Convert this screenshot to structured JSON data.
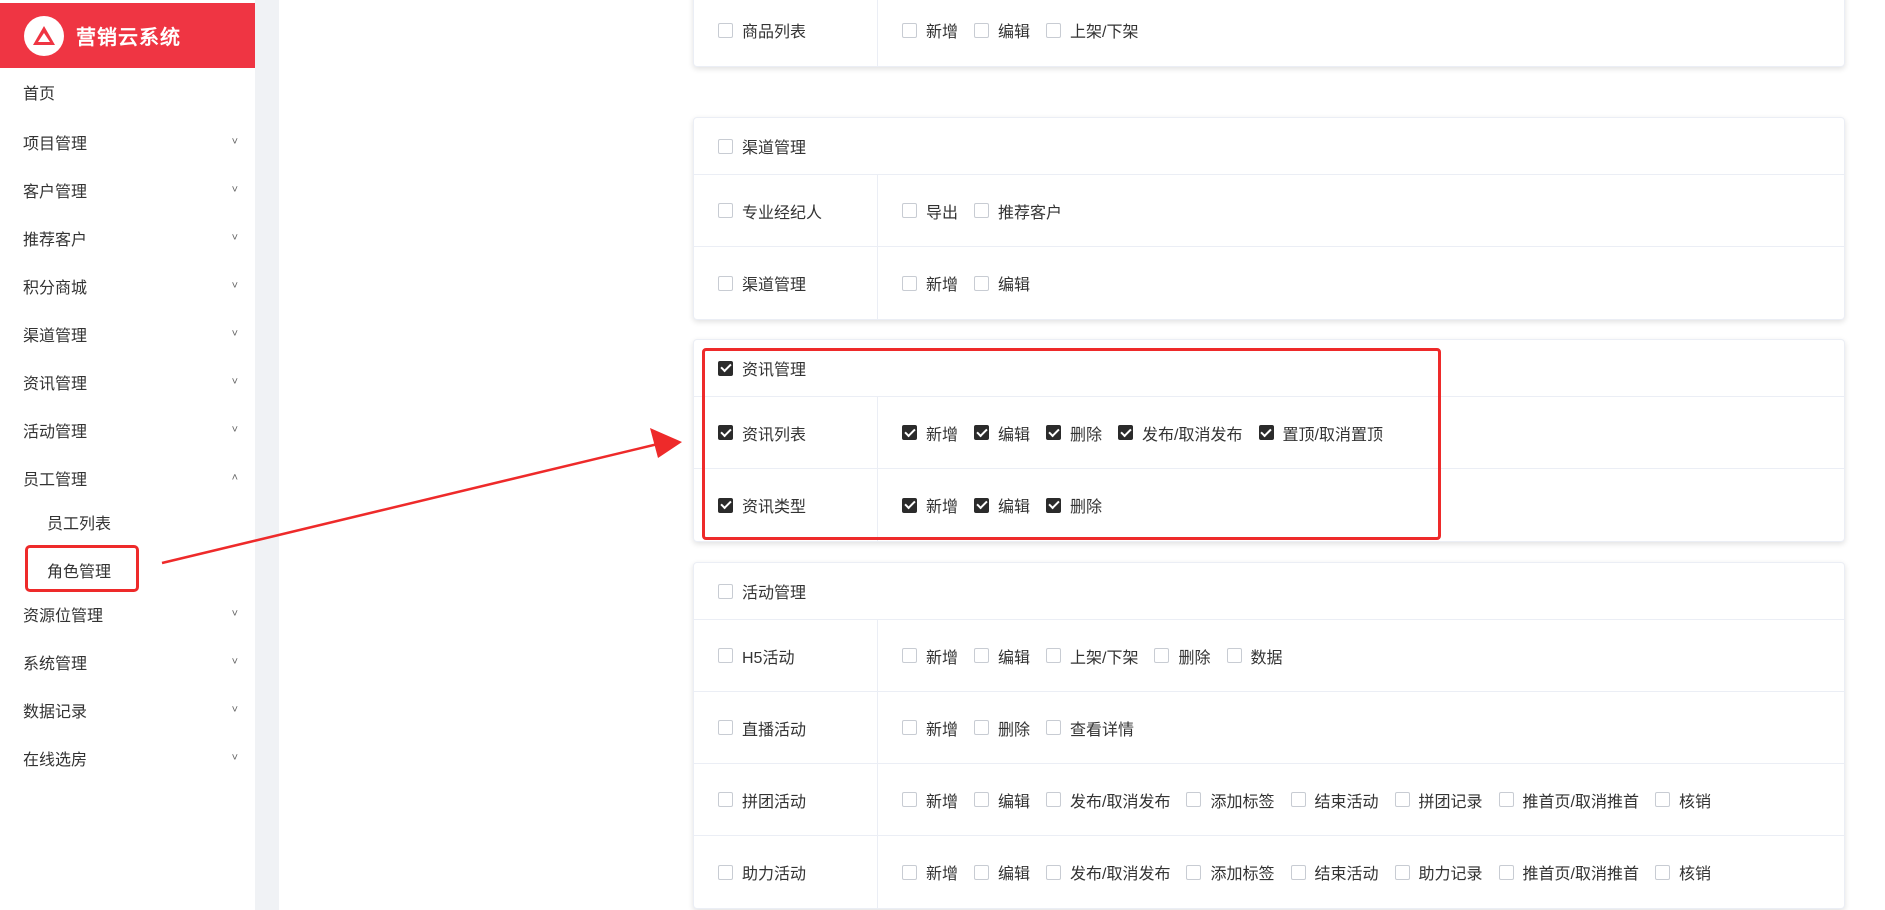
{
  "app": {
    "title": "营销云系统"
  },
  "sidebar": {
    "items": [
      {
        "label": "首页",
        "chevron": ""
      },
      {
        "label": "项目管理",
        "chevron": "˅"
      },
      {
        "label": "客户管理",
        "chevron": "˅"
      },
      {
        "label": "推荐客户",
        "chevron": "˅"
      },
      {
        "label": "积分商城",
        "chevron": "˅"
      },
      {
        "label": "渠道管理",
        "chevron": "˅"
      },
      {
        "label": "资讯管理",
        "chevron": "˅"
      },
      {
        "label": "活动管理",
        "chevron": "˅"
      },
      {
        "label": "员工管理",
        "chevron": "˄"
      },
      {
        "label": "资源位管理",
        "chevron": "˅"
      },
      {
        "label": "系统管理",
        "chevron": "˅"
      },
      {
        "label": "数据记录",
        "chevron": "˅"
      },
      {
        "label": "在线选房",
        "chevron": "˅"
      }
    ],
    "sub_items": [
      {
        "label": "员工列表"
      },
      {
        "label": "角色管理"
      }
    ]
  },
  "cards": [
    {
      "head": null,
      "rows": [
        {
          "label": "商品列表",
          "checked": false,
          "perms": [
            {
              "label": "新增",
              "checked": false
            },
            {
              "label": "编辑",
              "checked": false
            },
            {
              "label": "上架/下架",
              "checked": false
            }
          ]
        }
      ]
    },
    {
      "head": {
        "label": "渠道管理",
        "checked": false
      },
      "rows": [
        {
          "label": "专业经纪人",
          "checked": false,
          "perms": [
            {
              "label": "导出",
              "checked": false
            },
            {
              "label": "推荐客户",
              "checked": false
            }
          ]
        },
        {
          "label": "渠道管理",
          "checked": false,
          "perms": [
            {
              "label": "新增",
              "checked": false
            },
            {
              "label": "编辑",
              "checked": false
            }
          ]
        }
      ]
    },
    {
      "head": {
        "label": "资讯管理",
        "checked": true
      },
      "rows": [
        {
          "label": "资讯列表",
          "checked": true,
          "perms": [
            {
              "label": "新增",
              "checked": true
            },
            {
              "label": "编辑",
              "checked": true
            },
            {
              "label": "删除",
              "checked": true
            },
            {
              "label": "发布/取消发布",
              "checked": true
            },
            {
              "label": "置顶/取消置顶",
              "checked": true
            }
          ]
        },
        {
          "label": "资讯类型",
          "checked": true,
          "perms": [
            {
              "label": "新增",
              "checked": true
            },
            {
              "label": "编辑",
              "checked": true
            },
            {
              "label": "删除",
              "checked": true
            }
          ]
        }
      ]
    },
    {
      "head": {
        "label": "活动管理",
        "checked": false
      },
      "rows": [
        {
          "label": "H5活动",
          "checked": false,
          "perms": [
            {
              "label": "新增",
              "checked": false
            },
            {
              "label": "编辑",
              "checked": false
            },
            {
              "label": "上架/下架",
              "checked": false
            },
            {
              "label": "删除",
              "checked": false
            },
            {
              "label": "数据",
              "checked": false
            }
          ]
        },
        {
          "label": "直播活动",
          "checked": false,
          "perms": [
            {
              "label": "新增",
              "checked": false
            },
            {
              "label": "删除",
              "checked": false
            },
            {
              "label": "查看详情",
              "checked": false
            }
          ]
        },
        {
          "label": "拼团活动",
          "checked": false,
          "perms": [
            {
              "label": "新增",
              "checked": false
            },
            {
              "label": "编辑",
              "checked": false
            },
            {
              "label": "发布/取消发布",
              "checked": false
            },
            {
              "label": "添加标签",
              "checked": false
            },
            {
              "label": "结束活动",
              "checked": false
            },
            {
              "label": "拼团记录",
              "checked": false
            },
            {
              "label": "推首页/取消推首",
              "checked": false
            },
            {
              "label": "核销",
              "checked": false
            }
          ]
        },
        {
          "label": "助力活动",
          "checked": false,
          "perms": [
            {
              "label": "新增",
              "checked": false
            },
            {
              "label": "编辑",
              "checked": false
            },
            {
              "label": "发布/取消发布",
              "checked": false
            },
            {
              "label": "添加标签",
              "checked": false
            },
            {
              "label": "结束活动",
              "checked": false
            },
            {
              "label": "助力记录",
              "checked": false
            },
            {
              "label": "推首页/取消推首",
              "checked": false
            },
            {
              "label": "核销",
              "checked": false
            }
          ]
        }
      ]
    }
  ],
  "colors": {
    "brand": "#ef3543",
    "annotation": "#ee2a2a",
    "checked": "#2b2b2b"
  }
}
